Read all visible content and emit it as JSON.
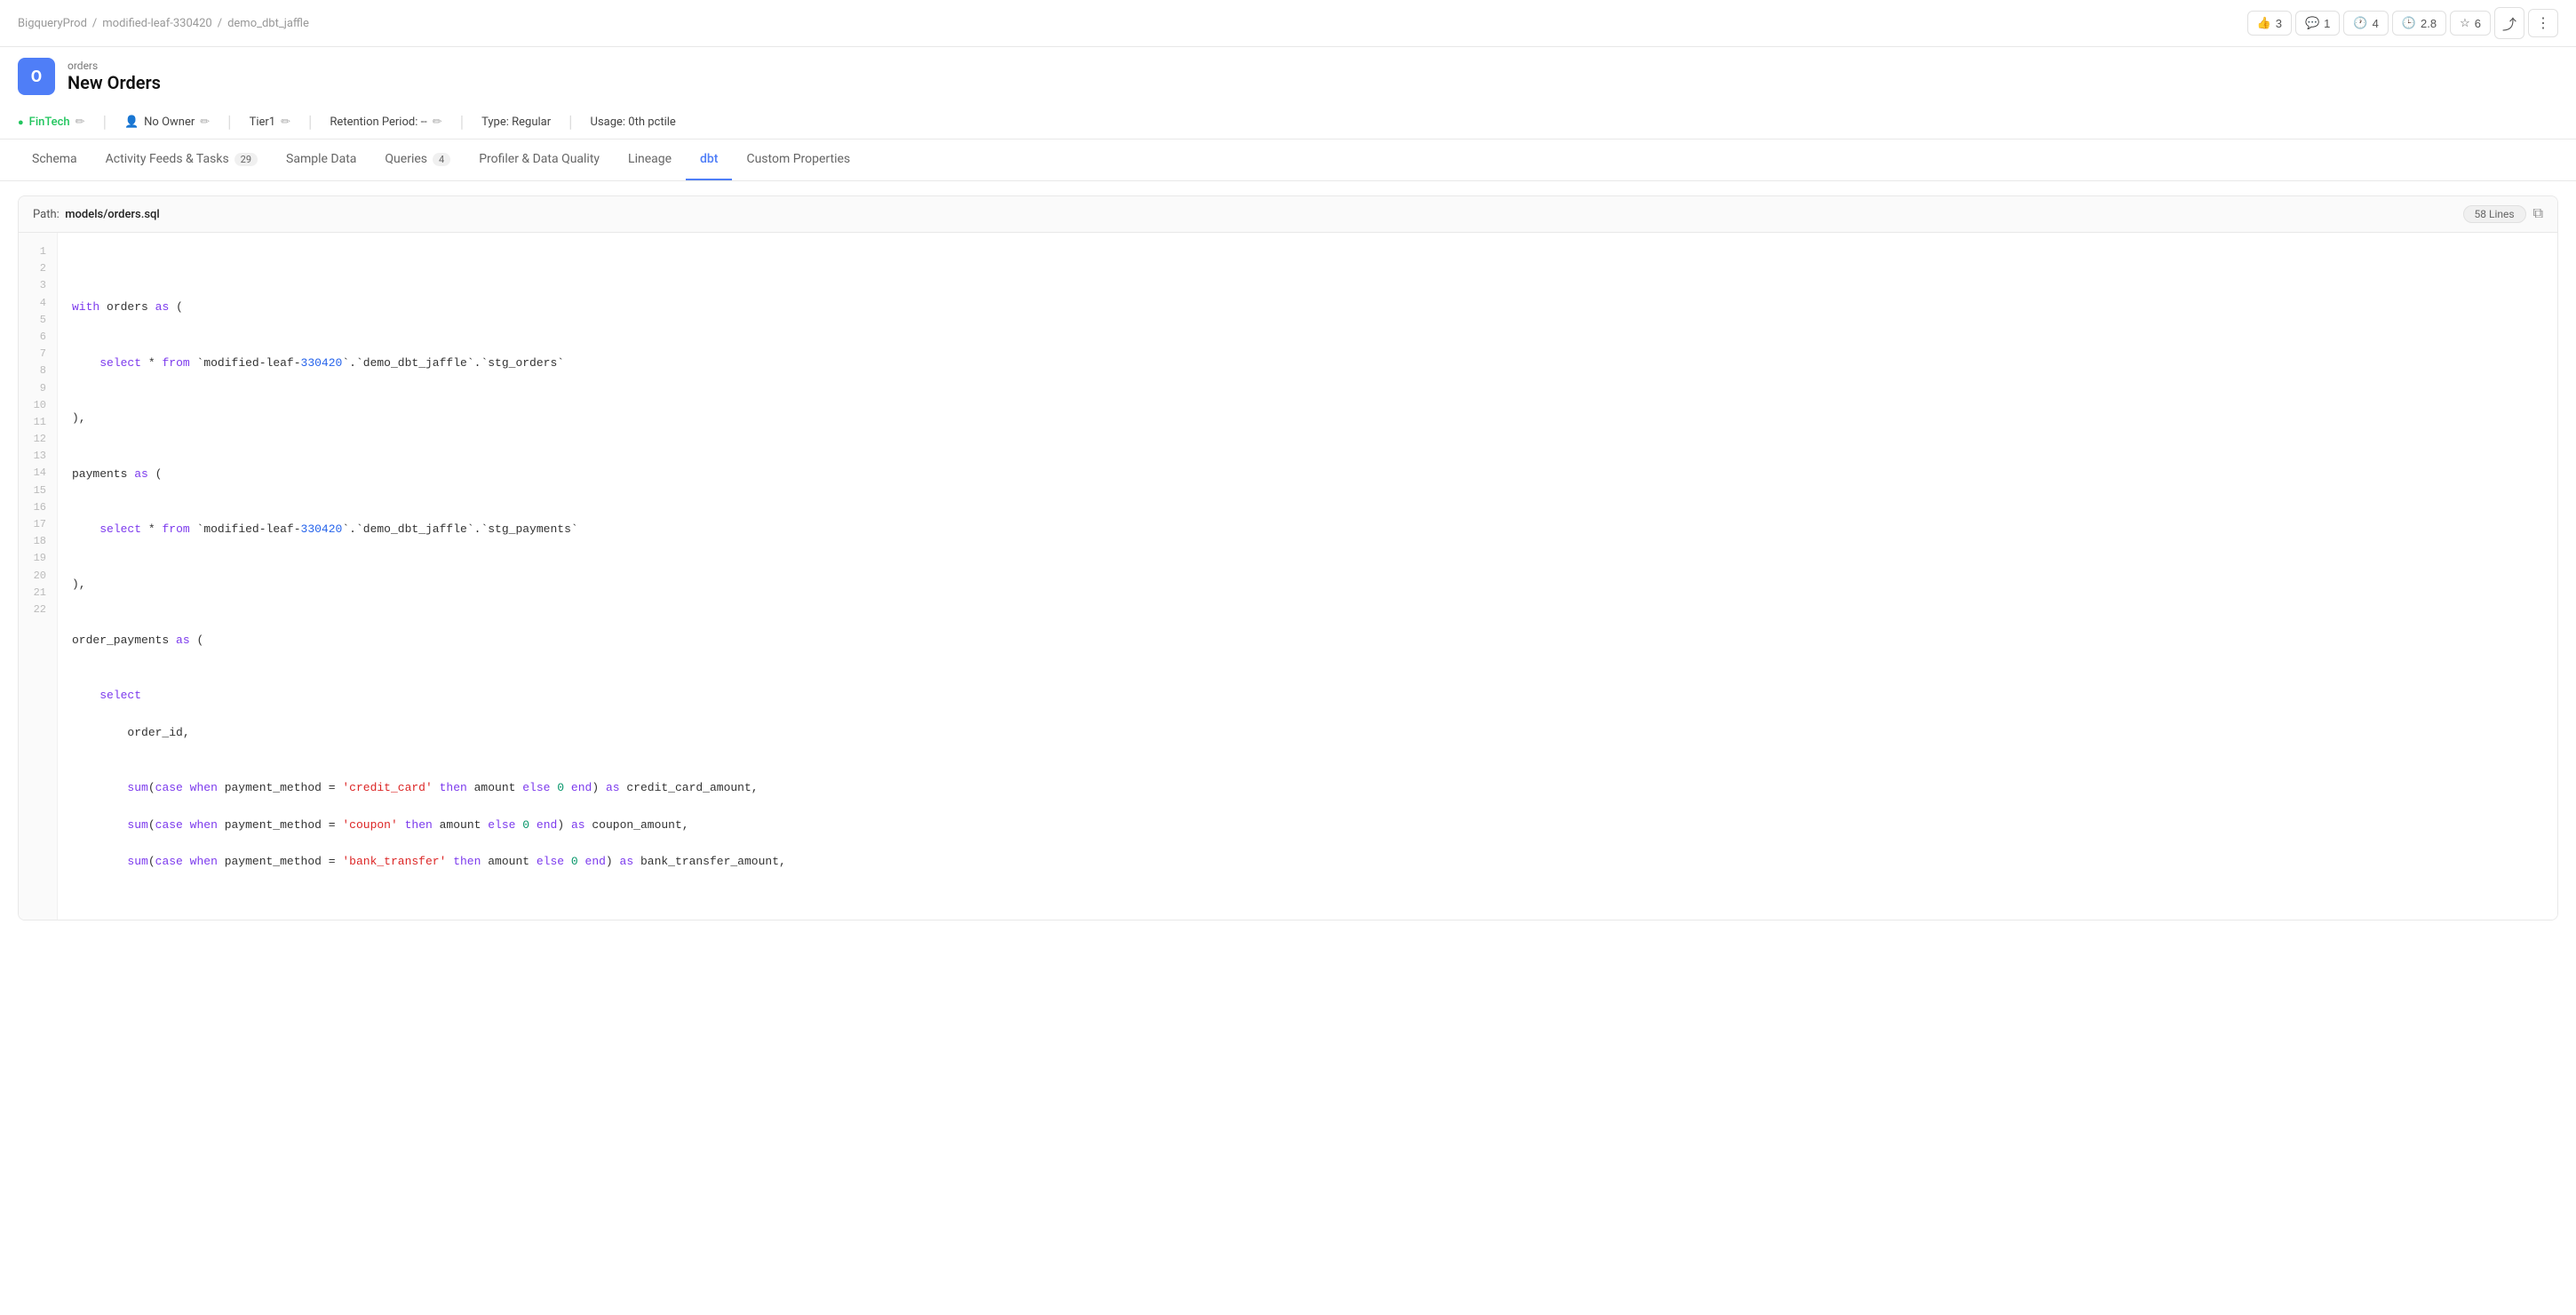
{
  "breadcrumb": {
    "items": [
      "BigqueryProd",
      "modified-leaf-330420",
      "demo_dbt_jaffle"
    ]
  },
  "topActions": {
    "likes": "3",
    "comments": "1",
    "views": "4",
    "rating": "2.8",
    "stars": "6"
  },
  "entity": {
    "avatarLetter": "O",
    "subtitle": "orders",
    "title": "New Orders"
  },
  "meta": {
    "domain": "FinTech",
    "owner": "No Owner",
    "tier": "Tier1",
    "retention": "Retention Period: --",
    "type": "Type: Regular",
    "usage": "Usage: 0th pctile"
  },
  "tabs": [
    {
      "label": "Schema",
      "badge": null,
      "active": false
    },
    {
      "label": "Activity Feeds & Tasks",
      "badge": "29",
      "active": false
    },
    {
      "label": "Sample Data",
      "badge": null,
      "active": false
    },
    {
      "label": "Queries",
      "badge": "4",
      "active": false
    },
    {
      "label": "Profiler & Data Quality",
      "badge": null,
      "active": false
    },
    {
      "label": "Lineage",
      "badge": null,
      "active": false
    },
    {
      "label": "dbt",
      "badge": null,
      "active": true
    },
    {
      "label": "Custom Properties",
      "badge": null,
      "active": false
    }
  ],
  "codePanel": {
    "pathLabel": "Path:",
    "path": "models/orders.sql",
    "linesLabel": "58 Lines"
  },
  "code": {
    "lines": 22
  }
}
